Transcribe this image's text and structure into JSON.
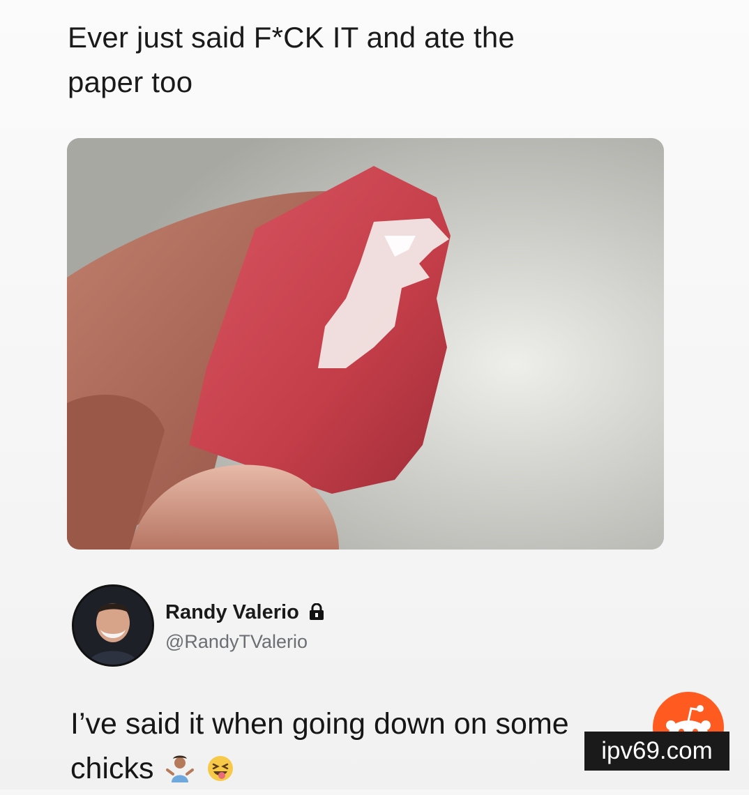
{
  "post": {
    "caption_line1": "Ever just said F*CK IT and ate the",
    "caption_line2": "paper too"
  },
  "photo": {
    "description_icon": "photo"
  },
  "profile": {
    "name": "Randy Valerio",
    "handle": "@RandyTValerio",
    "badge_icon": "lock-icon"
  },
  "reply": {
    "line1": "I’ve said it when going down on some",
    "line2": "chicks",
    "emojis": [
      "person-shrugging-emoji",
      "squinting-tongue-emoji"
    ]
  },
  "watermark": {
    "text": "ipv69.com",
    "icon": "reddit-icon"
  },
  "colors": {
    "candy": "#c9424c",
    "watermark_bg": "#1a1a1a",
    "reddit": "#ff5700"
  }
}
